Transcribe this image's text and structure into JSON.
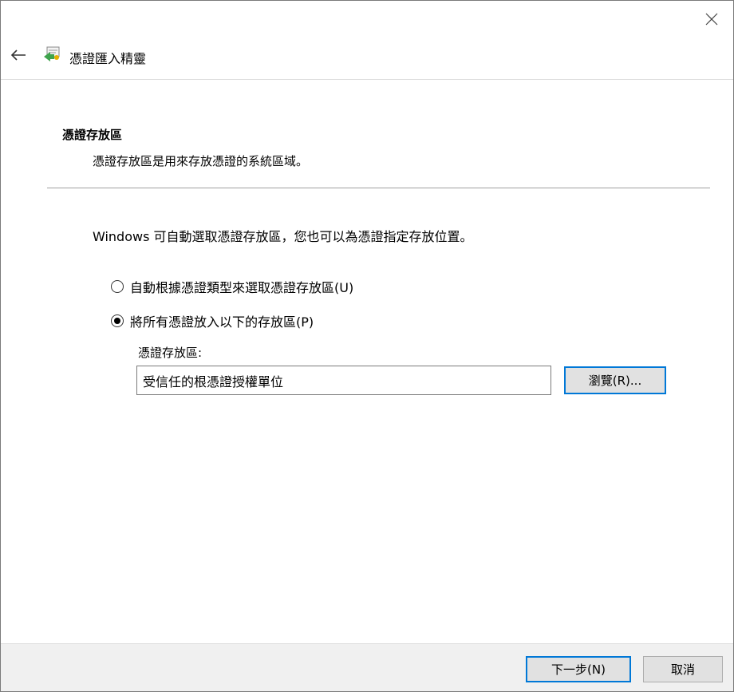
{
  "header": {
    "title": "憑證匯入精靈",
    "back_icon": "arrow-left-icon",
    "wizard_icon": "certificate-import-icon"
  },
  "window": {
    "close_icon": "close-icon"
  },
  "section": {
    "title": "憑證存放區",
    "description": "憑證存放區是用來存放憑證的系統區域。"
  },
  "main": {
    "intro": "Windows 可自動選取憑證存放區，您也可以為憑證指定存放位置。",
    "options": [
      {
        "label": "自動根據憑證類型來選取憑證存放區(U)",
        "selected": false
      },
      {
        "label": "將所有憑證放入以下的存放區(P)",
        "selected": true
      }
    ],
    "store_label": "憑證存放區:",
    "store_value": "受信任的根憑證授權單位",
    "browse_label": "瀏覽(R)..."
  },
  "footer": {
    "next_label": "下一步(N)",
    "cancel_label": "取消"
  },
  "colors": {
    "accent": "#0078d7",
    "button_face": "#e1e1e1",
    "footer_bg": "#f0f0f0"
  }
}
